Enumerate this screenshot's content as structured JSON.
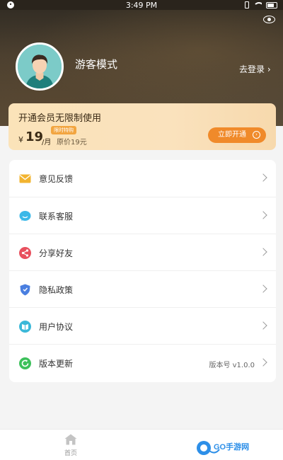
{
  "status_bar": {
    "time": "3:49 PM"
  },
  "profile": {
    "name": "游客模式",
    "login_link": "去登录 ›"
  },
  "vip": {
    "title": "开通会员无限制使用",
    "badge": "限时特购",
    "currency": "¥",
    "price": "19",
    "unit": "/月",
    "original_price": "原价19元",
    "button": "立即开通",
    "button_icon_glyph": "›"
  },
  "menu": {
    "items": [
      {
        "label": "意见反馈",
        "icon": "mail-icon",
        "color": "#f2b430"
      },
      {
        "label": "联系客服",
        "icon": "chat-bubble-icon",
        "color": "#3bb8e8"
      },
      {
        "label": "分享好友",
        "icon": "share-icon",
        "color": "#e8505e"
      },
      {
        "label": "隐私政策",
        "icon": "shield-icon",
        "color": "#4a7fe0"
      },
      {
        "label": "用户协议",
        "icon": "book-icon",
        "color": "#3bb8d8"
      },
      {
        "label": "版本更新",
        "icon": "refresh-icon",
        "color": "#3cc05a",
        "extra": "版本号 v1.0.0"
      }
    ]
  },
  "tabbar": {
    "home_label": "首页"
  },
  "watermark": {
    "text": "GO手游网"
  },
  "colors": {
    "accent_orange": "#f08a2a",
    "vip_gold": "#fbe3b9"
  }
}
